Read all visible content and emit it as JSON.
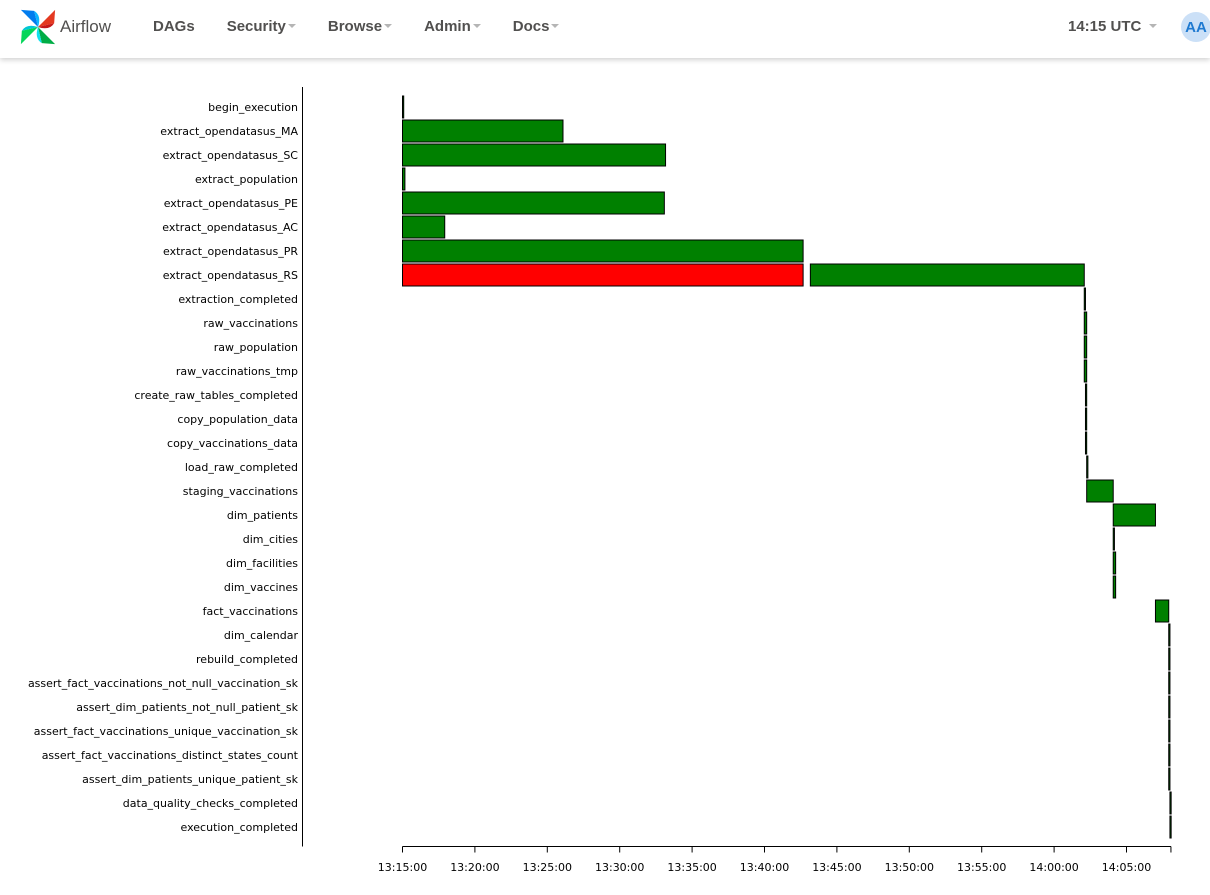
{
  "navbar": {
    "brand": "Airflow",
    "menu": [
      "DAGs",
      "Security",
      "Browse",
      "Admin",
      "Docs"
    ],
    "clock": "14:15 UTC",
    "user_initials": "AA"
  },
  "chart_data": {
    "type": "gantt",
    "x_axis": {
      "ticks": [
        "13:15:00",
        "13:20:00",
        "13:25:00",
        "13:30:00",
        "13:35:00",
        "13:40:00",
        "13:45:00",
        "13:50:00",
        "13:55:00",
        "14:00:00",
        "14:05:00"
      ],
      "range": [
        "13:15:00",
        "14:08:00"
      ]
    },
    "colors": {
      "success": "#008000",
      "failed": "#ff0000"
    },
    "tasks": [
      {
        "name": "begin_execution",
        "bars": [
          {
            "start": "13:15:00",
            "end": "13:15:05",
            "state": "success"
          }
        ]
      },
      {
        "name": "extract_opendatasus_MA",
        "bars": [
          {
            "start": "13:15:00",
            "end": "13:26:05",
            "state": "success"
          }
        ]
      },
      {
        "name": "extract_opendatasus_SC",
        "bars": [
          {
            "start": "13:15:00",
            "end": "13:33:10",
            "state": "success"
          }
        ]
      },
      {
        "name": "extract_population",
        "bars": [
          {
            "start": "13:15:00",
            "end": "13:15:10",
            "state": "success"
          }
        ]
      },
      {
        "name": "extract_opendatasus_PE",
        "bars": [
          {
            "start": "13:15:00",
            "end": "13:33:05",
            "state": "success"
          }
        ]
      },
      {
        "name": "extract_opendatasus_AC",
        "bars": [
          {
            "start": "13:15:00",
            "end": "13:17:55",
            "state": "success"
          }
        ]
      },
      {
        "name": "extract_opendatasus_PR",
        "bars": [
          {
            "start": "13:15:00",
            "end": "13:42:40",
            "state": "success"
          }
        ]
      },
      {
        "name": "extract_opendatasus_RS",
        "bars": [
          {
            "start": "13:15:00",
            "end": "13:42:40",
            "state": "failed"
          },
          {
            "start": "13:43:10",
            "end": "14:02:05",
            "state": "success"
          }
        ]
      },
      {
        "name": "extraction_completed",
        "bars": [
          {
            "start": "14:02:05",
            "end": "14:02:10",
            "state": "success"
          }
        ]
      },
      {
        "name": "raw_vaccinations",
        "bars": [
          {
            "start": "14:02:05",
            "end": "14:02:15",
            "state": "success"
          }
        ]
      },
      {
        "name": "raw_population",
        "bars": [
          {
            "start": "14:02:05",
            "end": "14:02:15",
            "state": "success"
          }
        ]
      },
      {
        "name": "raw_vaccinations_tmp",
        "bars": [
          {
            "start": "14:02:05",
            "end": "14:02:15",
            "state": "success"
          }
        ]
      },
      {
        "name": "create_raw_tables_completed",
        "bars": [
          {
            "start": "14:02:10",
            "end": "14:02:15",
            "state": "success"
          }
        ]
      },
      {
        "name": "copy_population_data",
        "bars": [
          {
            "start": "14:02:10",
            "end": "14:02:15",
            "state": "success"
          }
        ]
      },
      {
        "name": "copy_vaccinations_data",
        "bars": [
          {
            "start": "14:02:10",
            "end": "14:02:15",
            "state": "success"
          }
        ]
      },
      {
        "name": "load_raw_completed",
        "bars": [
          {
            "start": "14:02:15",
            "end": "14:02:20",
            "state": "success"
          }
        ]
      },
      {
        "name": "staging_vaccinations",
        "bars": [
          {
            "start": "14:02:15",
            "end": "14:04:05",
            "state": "success"
          }
        ]
      },
      {
        "name": "dim_patients",
        "bars": [
          {
            "start": "14:04:05",
            "end": "14:07:00",
            "state": "success"
          }
        ]
      },
      {
        "name": "dim_cities",
        "bars": [
          {
            "start": "14:04:05",
            "end": "14:04:10",
            "state": "success"
          }
        ]
      },
      {
        "name": "dim_facilities",
        "bars": [
          {
            "start": "14:04:05",
            "end": "14:04:15",
            "state": "success"
          }
        ]
      },
      {
        "name": "dim_vaccines",
        "bars": [
          {
            "start": "14:04:05",
            "end": "14:04:15",
            "state": "success"
          }
        ]
      },
      {
        "name": "fact_vaccinations",
        "bars": [
          {
            "start": "14:07:00",
            "end": "14:07:55",
            "state": "success"
          }
        ]
      },
      {
        "name": "dim_calendar",
        "bars": [
          {
            "start": "14:07:55",
            "end": "14:08:00",
            "state": "success"
          }
        ]
      },
      {
        "name": "rebuild_completed",
        "bars": [
          {
            "start": "14:07:55",
            "end": "14:08:00",
            "state": "success"
          }
        ]
      },
      {
        "name": "assert_fact_vaccinations_not_null_vaccination_sk",
        "bars": [
          {
            "start": "14:07:55",
            "end": "14:08:00",
            "state": "success"
          }
        ]
      },
      {
        "name": "assert_dim_patients_not_null_patient_sk",
        "bars": [
          {
            "start": "14:07:55",
            "end": "14:08:00",
            "state": "success"
          }
        ]
      },
      {
        "name": "assert_fact_vaccinations_unique_vaccination_sk",
        "bars": [
          {
            "start": "14:07:55",
            "end": "14:08:00",
            "state": "success"
          }
        ]
      },
      {
        "name": "assert_fact_vaccinations_distinct_states_count",
        "bars": [
          {
            "start": "14:07:55",
            "end": "14:08:00",
            "state": "success"
          }
        ]
      },
      {
        "name": "assert_dim_patients_unique_patient_sk",
        "bars": [
          {
            "start": "14:07:55",
            "end": "14:08:00",
            "state": "success"
          }
        ]
      },
      {
        "name": "data_quality_checks_completed",
        "bars": [
          {
            "start": "14:08:00",
            "end": "14:08:05",
            "state": "success"
          }
        ]
      },
      {
        "name": "execution_completed",
        "bars": [
          {
            "start": "14:08:00",
            "end": "14:08:05",
            "state": "success"
          }
        ]
      }
    ]
  }
}
